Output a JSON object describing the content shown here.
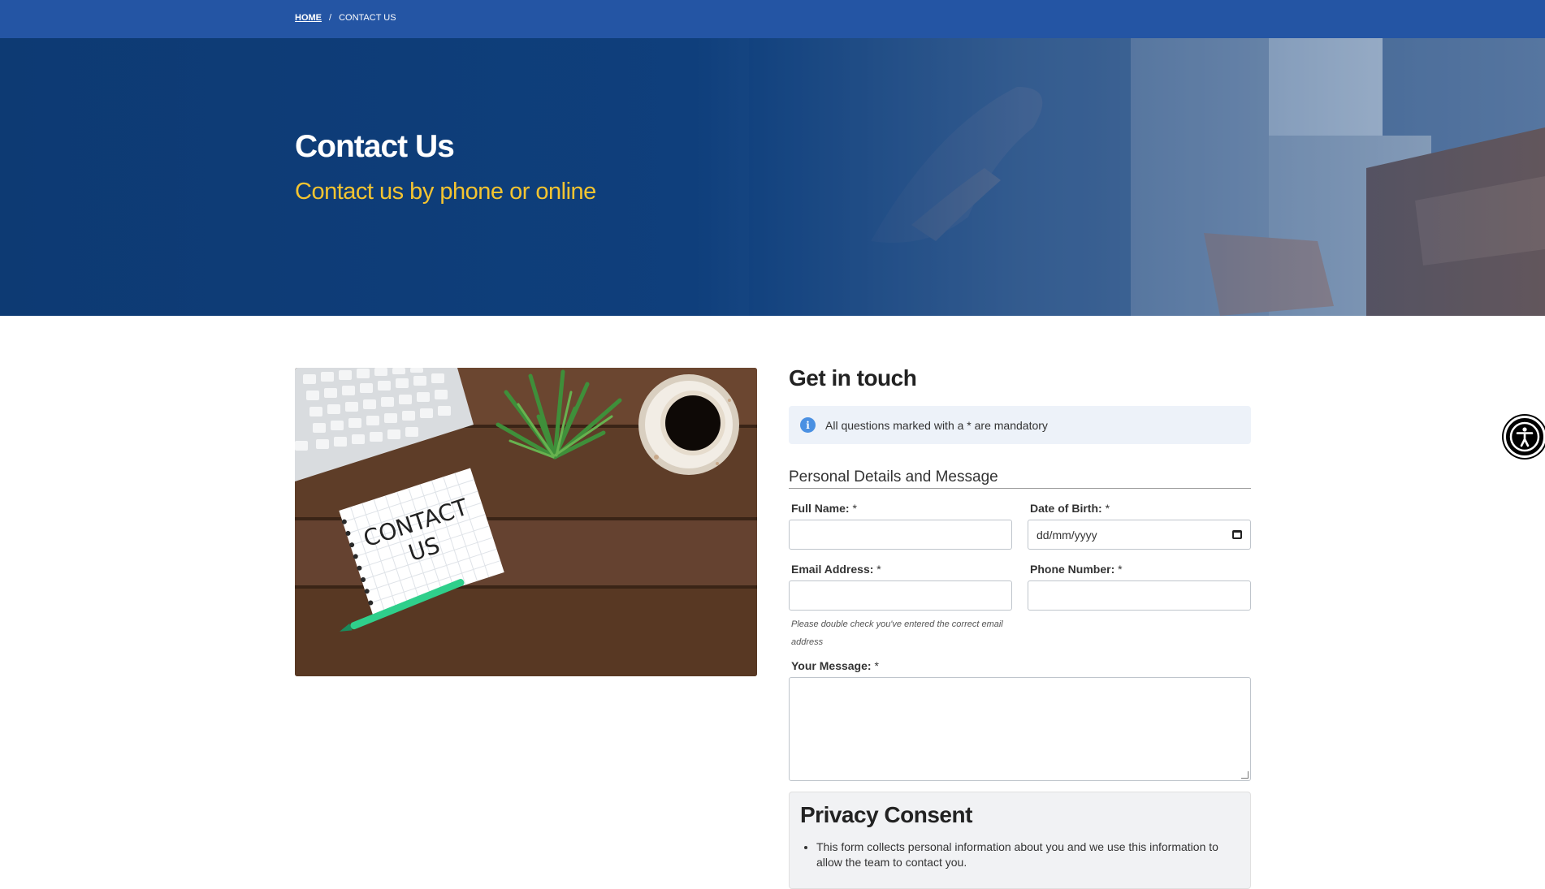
{
  "breadcrumb": {
    "home": "HOME",
    "separator": "/",
    "current": "CONTACT US"
  },
  "hero": {
    "title": "Contact Us",
    "subtitle": "Contact us by phone or online"
  },
  "image": {
    "note_line1": "CONTACT",
    "note_line2": "US"
  },
  "form": {
    "heading": "Get in touch",
    "info": "All questions marked with a * are mandatory",
    "info_icon": "info-icon",
    "legend": "Personal Details and Message",
    "required_mark": "*",
    "full_name_label": "Full Name:",
    "dob_label": "Date of Birth:",
    "dob_placeholder": "dd/mm/yyyy",
    "email_label": "Email Address:",
    "email_help": "Please double check you've entered the correct email address",
    "phone_label": "Phone Number:",
    "message_label": "Your Message:"
  },
  "privacy": {
    "title_light": "Privacy",
    "title_bold": "Consent",
    "item1": "This form collects personal information about you and we use this information to allow the team to contact you."
  },
  "accessibility": {
    "icon": "accessibility-icon"
  },
  "colors": {
    "topbar": "#2455a4",
    "hero": "#0f3f7c",
    "subtitle": "#f4c430",
    "info_bg": "#edf2f9",
    "info_icon": "#4a90e2"
  }
}
